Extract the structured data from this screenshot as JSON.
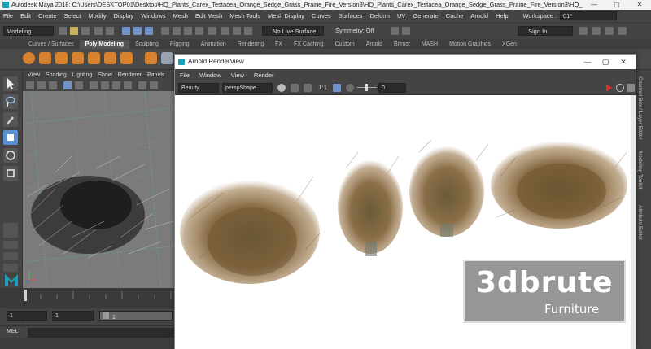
{
  "window": {
    "title": "Autodesk Maya 2018: C:\\Users\\DESKTOP01\\Desktop\\HQ_Plants_Carex_Testacea_Orange_Sedge_Grass_Prairie_Fire_Version3\\HQ_Plants_Carex_Testacea_Orange_Sedge_Grass_Prairie_Fire_Version3\\HQ_Plants_Carex_Testacea_Orang...",
    "min": "—",
    "max": "▢",
    "close": "✕"
  },
  "menubar": {
    "items": [
      "File",
      "Edit",
      "Create",
      "Select",
      "Modify",
      "Display",
      "Windows",
      "Mesh",
      "Edit Mesh",
      "Mesh Tools",
      "Mesh Display",
      "Curves",
      "Surfaces",
      "Deform",
      "UV",
      "Generate",
      "Cache",
      "Arnold",
      "Help"
    ],
    "workspace_label": "Workspace :",
    "workspace_value": "01*"
  },
  "statusline": {
    "mode": "Modeling",
    "live_surface": "No Live Surface",
    "symmetry": "Symmetry: Off",
    "signin": "Sign In"
  },
  "shelf": {
    "tabs": [
      "Curves / Surfaces",
      "Poly Modeling",
      "Sculpting",
      "Rigging",
      "Animation",
      "Rendering",
      "FX",
      "FX Caching",
      "Custom",
      "Arnold",
      "Bifrost",
      "MASH",
      "Motion Graphics",
      "XGen"
    ],
    "active_tab": "Poly Modeling"
  },
  "viewport": {
    "menu": [
      "View",
      "Shading",
      "Lighting",
      "Show",
      "Renderer",
      "Panels"
    ]
  },
  "timeline": {
    "start": "1",
    "current": "1",
    "range_start": "1",
    "range_end": "1"
  },
  "cmdline": {
    "label": "MEL"
  },
  "rightstrip": {
    "tabs": [
      "Channel Box / Layer Editor",
      "Modeling Toolkit",
      "Attribute Editor"
    ]
  },
  "renderview": {
    "title": "Arnold RenderView",
    "min": "—",
    "max": "▢",
    "close": "✕",
    "menu": [
      "File",
      "Window",
      "View",
      "Render"
    ],
    "aov": "Beauty",
    "camera": "perspShape",
    "ratio": "1:1",
    "exposure": "0"
  },
  "watermark": {
    "brand": "3dbrute",
    "sub": "Furniture"
  }
}
